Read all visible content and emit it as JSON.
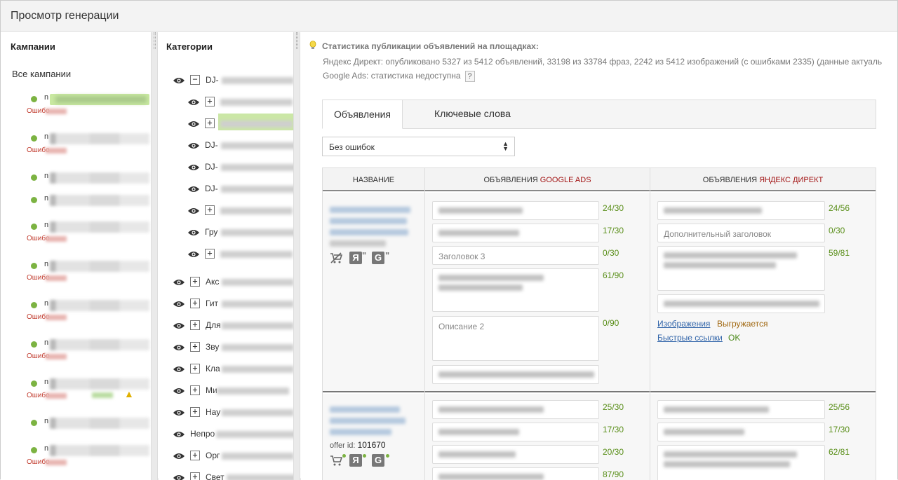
{
  "window": {
    "title": "Просмотр генерации"
  },
  "campaigns": {
    "header": "Кампании",
    "all_label": "Все кампании",
    "items": [
      {
        "prefix": "n",
        "error_label": "Ошибо",
        "selected": true
      },
      {
        "prefix": "n",
        "error_label": "Ошибо"
      },
      {
        "prefix": "n",
        "error_label": ""
      },
      {
        "prefix": "n",
        "error_label": ""
      },
      {
        "prefix": "n",
        "error_label": "Ошибо"
      },
      {
        "prefix": "n",
        "error_label": "Ошибо"
      },
      {
        "prefix": "n",
        "error_label": "Ошибо"
      },
      {
        "prefix": "n",
        "error_label": "Ошибо"
      },
      {
        "prefix": "n",
        "error_label": "Ошибо",
        "warning": true
      },
      {
        "prefix": "n",
        "error_label": ""
      },
      {
        "prefix": "n",
        "error_label": "Ошибо"
      }
    ]
  },
  "categories": {
    "header": "Категории",
    "items": [
      {
        "label": "DJ-",
        "toggle": "−"
      },
      {
        "label": "",
        "toggle": "+"
      },
      {
        "label": "",
        "toggle": "+"
      },
      {
        "label": "DJ-",
        "toggle": ""
      },
      {
        "label": "DJ-",
        "toggle": ""
      },
      {
        "label": "DJ-",
        "toggle": ""
      },
      {
        "label": "",
        "toggle": "+"
      },
      {
        "label": "Гру",
        "toggle": ""
      },
      {
        "label": "",
        "toggle": "+"
      },
      {
        "label": "Акс",
        "toggle": "+"
      },
      {
        "label": "Гит",
        "toggle": "+"
      },
      {
        "label": "Для",
        "toggle": "+"
      },
      {
        "label": "Зву",
        "toggle": "+"
      },
      {
        "label": "Кла",
        "toggle": "+"
      },
      {
        "label": "Ми",
        "toggle": "+"
      },
      {
        "label": "Нау",
        "toggle": "+"
      },
      {
        "label": "Непро",
        "toggle": ""
      },
      {
        "label": "Орг",
        "toggle": "+"
      },
      {
        "label": "Свет",
        "toggle": "+"
      }
    ]
  },
  "stats": {
    "title": "Статистика публикации объявлений на площадках:",
    "yandex_line": "Яндекс Директ: опубликовано 5327 из 5412 объявлений, 33198 из 33784 фраз, 2242 из 5412 изображений (с ошибками 2335) (данные актуаль",
    "google_line": "Google Ads: статистика недоступна",
    "help_label": "?"
  },
  "tabs": [
    {
      "label": "Объявления",
      "active": true
    },
    {
      "label": "Ключевые слова",
      "active": false
    }
  ],
  "filter": {
    "selected": "Без ошибок",
    "arrow_up": "▲",
    "arrow_down": "▼"
  },
  "table": {
    "col_name": "НАЗВАНИЕ",
    "col_google_prefix": "ОБЪЯВЛЕНИЯ ",
    "col_google_accent": "GOOGLE ADS",
    "col_yandex_prefix": "ОБЪЯВЛЕНИЯ ",
    "col_yandex_accent": "ЯНДЕКС ДИРЕКТ",
    "rows": [
      {
        "offer_label": "",
        "offer_value": "",
        "google": {
          "headline1_count": "24/30",
          "headline2_count": "17/30",
          "headline3_placeholder": "Заголовок 3",
          "headline3_count": "0/30",
          "desc1_count": "61/90",
          "desc2_placeholder": "Описание 2",
          "desc2_count": "0/90"
        },
        "yandex": {
          "title_count": "24/56",
          "extra_title_placeholder": "Дополнительный заголовок",
          "extra_title_count": "0/30",
          "text_count": "59/81",
          "images_link": "Изображения",
          "images_status": "Выгружается",
          "sitelinks_link": "Быстрые ссылки",
          "sitelinks_status": "OK"
        }
      },
      {
        "offer_label": "offer id:",
        "offer_value": "101670",
        "google": {
          "headline1_count": "25/30",
          "headline2_count": "17/30",
          "headline3_count": "20/30",
          "desc1_count": "87/90"
        },
        "yandex": {
          "title_count": "25/56",
          "extra_title_count": "17/30",
          "text_count": "62/81"
        }
      }
    ]
  },
  "icons": {
    "bulb": "lightbulb-icon",
    "eye": "eye-icon",
    "cart": "cart-crossed-icon",
    "yandex": "yandex-icon",
    "google": "google-icon",
    "warning": "warning-icon"
  },
  "colors": {
    "accent_red": "#a31515",
    "count_green": "#5a8f1a",
    "status_dot": "#7cb342",
    "selected_bg": "#cbe7a6",
    "error_red": "#c0392b",
    "link_blue": "#3366aa"
  }
}
